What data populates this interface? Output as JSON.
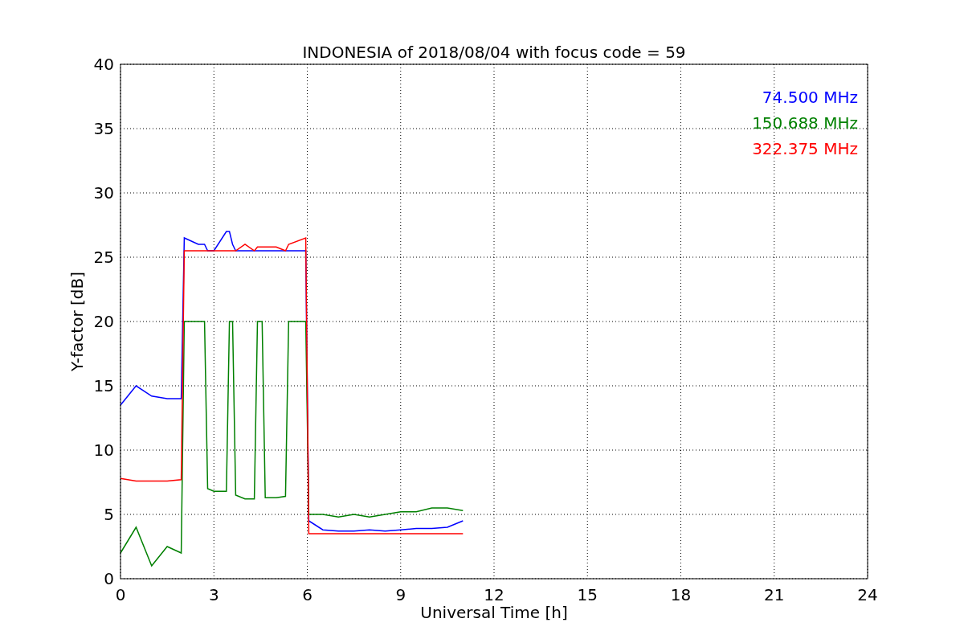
{
  "chart_data": {
    "type": "line",
    "title": "INDONESIA of 2018/08/04 with focus code = 59",
    "xlabel": "Universal Time [h]",
    "ylabel": "Y-factor [dB]",
    "x": [
      0,
      0.5,
      1,
      1.5,
      1.95,
      2.05,
      2.5,
      2.7,
      2.8,
      3,
      3.4,
      3.5,
      3.6,
      3.7,
      4,
      4.3,
      4.4,
      4.55,
      4.65,
      5,
      5.3,
      5.4,
      5.95,
      6.05,
      6.5,
      7,
      7.5,
      8,
      8.5,
      9,
      9.5,
      10,
      10.5,
      11
    ],
    "series": [
      {
        "name": "74.500 MHz",
        "color": "#0000ff",
        "values": [
          13.5,
          15,
          14.2,
          14,
          14,
          26.5,
          26,
          26,
          25.5,
          25.5,
          27,
          27,
          26,
          25.5,
          25.5,
          25.5,
          25.5,
          25.5,
          25.5,
          25.5,
          25.5,
          25.5,
          25.5,
          4.5,
          3.8,
          3.7,
          3.7,
          3.8,
          3.7,
          3.8,
          3.9,
          3.9,
          4,
          4.5
        ]
      },
      {
        "name": "150.688 MHz",
        "color": "#008000",
        "values": [
          2,
          4,
          1,
          2.5,
          2,
          20,
          20,
          20,
          7,
          6.8,
          6.8,
          20,
          20,
          6.5,
          6.2,
          6.2,
          20,
          20,
          6.3,
          6.3,
          6.4,
          20,
          20,
          5,
          5,
          4.8,
          5,
          4.8,
          5,
          5.2,
          5.2,
          5.5,
          5.5,
          5.3
        ]
      },
      {
        "name": "322.375 MHz",
        "color": "#ff0000",
        "values": [
          7.8,
          7.6,
          7.6,
          7.6,
          7.7,
          25.5,
          25.5,
          25.5,
          25.5,
          25.5,
          25.5,
          25.5,
          25.5,
          25.5,
          26,
          25.5,
          25.8,
          25.8,
          25.8,
          25.8,
          25.5,
          26,
          26.5,
          3.5,
          3.5,
          3.5,
          3.5,
          3.5,
          3.5,
          3.5,
          3.5,
          3.5,
          3.5,
          3.5
        ]
      }
    ],
    "grid": true,
    "xlim": [
      0,
      24
    ],
    "ylim": [
      0,
      40
    ],
    "xticks": [
      0,
      3,
      6,
      9,
      12,
      15,
      18,
      21,
      24
    ],
    "yticks": [
      0,
      5,
      10,
      15,
      20,
      25,
      30,
      35,
      40
    ]
  }
}
